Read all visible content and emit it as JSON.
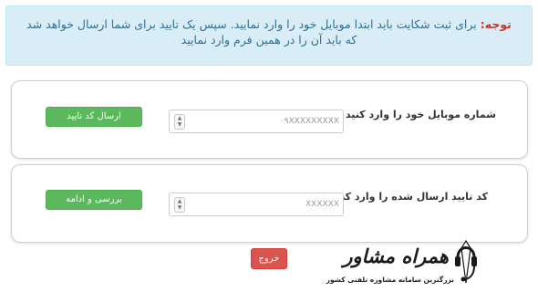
{
  "notice": {
    "lead": "توجه:",
    "message": "برای ثبت شکایت باید ابتدا موبایل خود را وارد نمایید. سپس یک تایید برای شما ارسال خواهد شد که باید آن را در همین فرم وارد نمایید"
  },
  "phone_section": {
    "label": "شماره موبایل خود را وارد کنید",
    "input_placeholder": "۰۹XXXXXXXXX",
    "button_label": "ارسال کد تایید"
  },
  "code_section": {
    "label": "کد تایید ارسال شده را وارد کنید",
    "input_placeholder": "XXXXXX",
    "button_label": "بررسی و ادامه"
  },
  "exit_button_label": "خروج",
  "logo": {
    "name": "همراه مشاور",
    "tagline": "بزرگترین سامانه مشاوره تلفنی کشور"
  },
  "colors": {
    "notice_bg": "#d9edf7",
    "notice_text": "#31708f",
    "notice_lead": "#c0392b",
    "button_green": "#5cb85c",
    "button_red": "#d9534f"
  }
}
